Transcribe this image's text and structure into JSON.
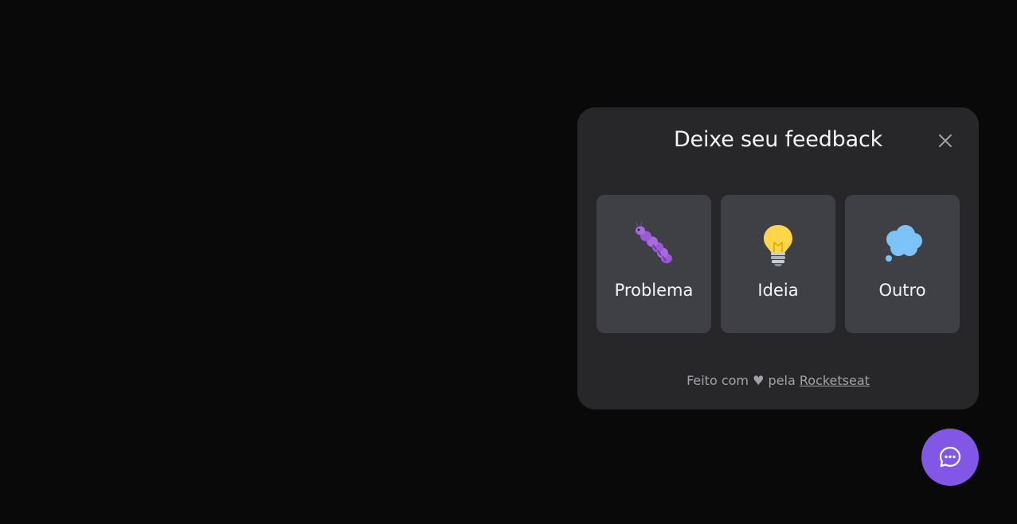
{
  "widget": {
    "title": "Deixe seu feedback",
    "close_icon": "x-close-icon",
    "options": [
      {
        "label": "Problema",
        "icon": "bug-emoji-icon"
      },
      {
        "label": "Ideia",
        "icon": "lightbulb-emoji-icon"
      },
      {
        "label": "Outro",
        "icon": "thought-balloon-emoji-icon"
      }
    ],
    "footer": {
      "prefix": "Feito com",
      "heart": "♥",
      "middle": "pela",
      "link_text": "Rocketseat"
    }
  },
  "fab": {
    "icon": "chat-dots-icon",
    "color": "#8257e5"
  },
  "colors": {
    "background": "#09090a",
    "panel": "#27272a",
    "card": "#3f3f46",
    "accent": "#8257e5"
  }
}
